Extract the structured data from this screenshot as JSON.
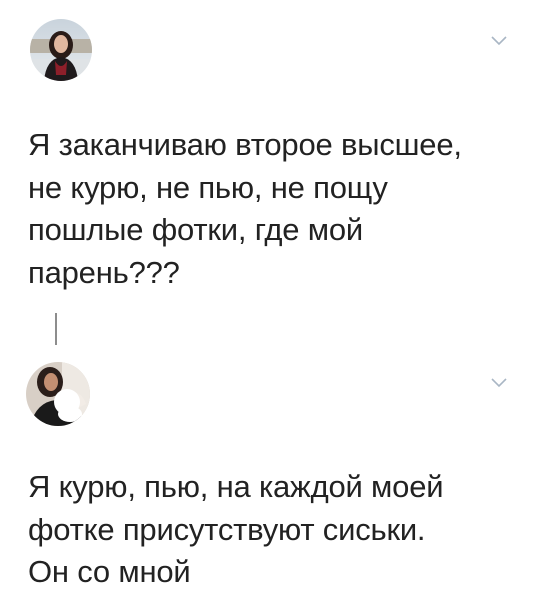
{
  "tweets": [
    {
      "lines": [
        "Я заканчиваю второе высшее,",
        "не курю, не пью, не пощу",
        "пошлые фотки, где мой",
        "парень???"
      ]
    },
    {
      "lines": [
        "Я курю, пью, на каждой моей",
        "фотке присутствуют сиськи.",
        "Он со мной"
      ]
    }
  ],
  "icons": {
    "menu": "chevron-down-icon",
    "avatar": "avatar"
  },
  "colors": {
    "text": "#222222",
    "chevron": "#a9b6c4",
    "thread_line": "#8d8d8d"
  }
}
